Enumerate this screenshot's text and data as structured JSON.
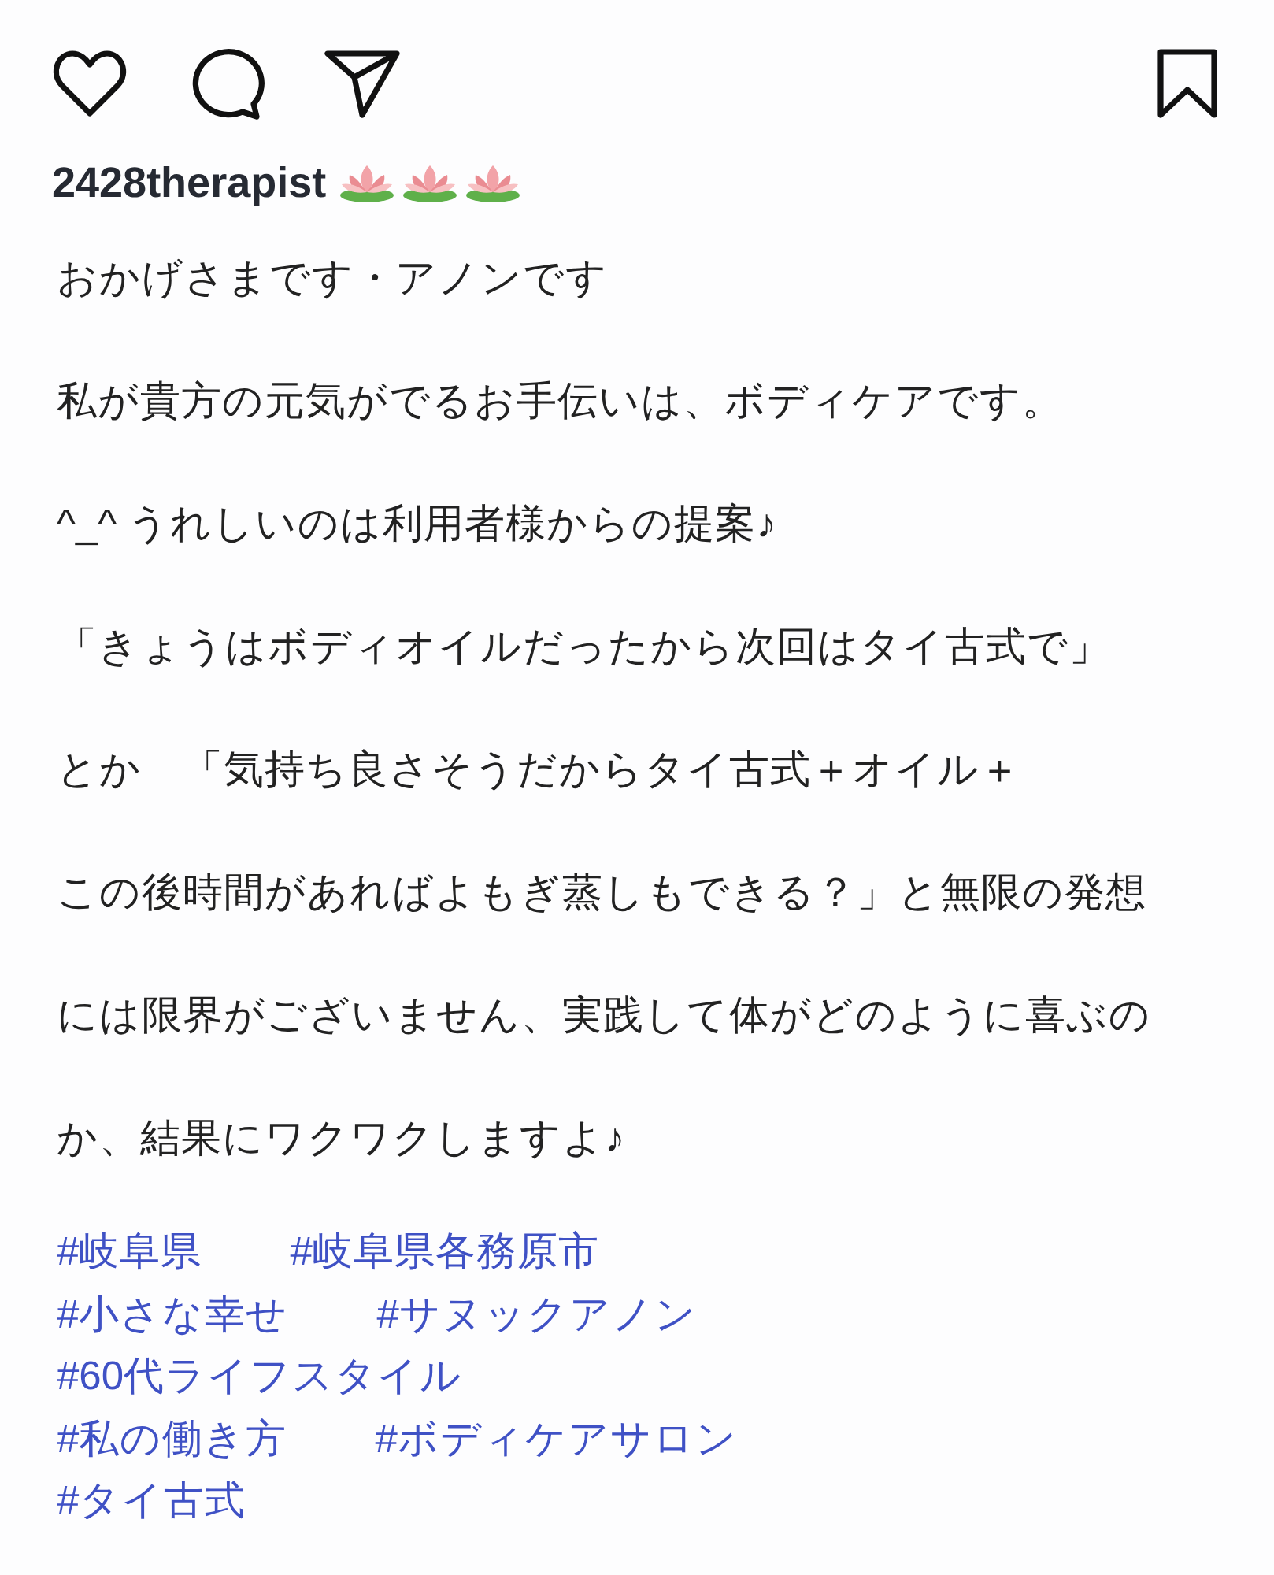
{
  "post": {
    "username": "2428therapist",
    "caption": [
      "おかげさまです・アノンです",
      "私が貴方の元気がでるお手伝いは、ボディケアです。",
      "^_^ うれしいのは利用者様からの提案♪",
      "「きょうはボディオイルだったから次回はタイ古式で」",
      "とか　「気持ち良さそうだからタイ古式＋オイル＋",
      "この後時間があればよもぎ蒸しもできる？」と無限の発想",
      "には限界がございません、実践して体がどのように喜ぶの",
      "か、結果にワクワクしますよ♪"
    ],
    "hashtag_rows": [
      [
        "#岐阜県",
        "#岐阜県各務原市"
      ],
      [
        "#小さな幸せ",
        "#サヌックアノン"
      ],
      [
        "#60代ライフスタイル"
      ],
      [
        "#私の働き方",
        "#ボディケアサロン"
      ],
      [
        "#タイ古式"
      ]
    ]
  }
}
